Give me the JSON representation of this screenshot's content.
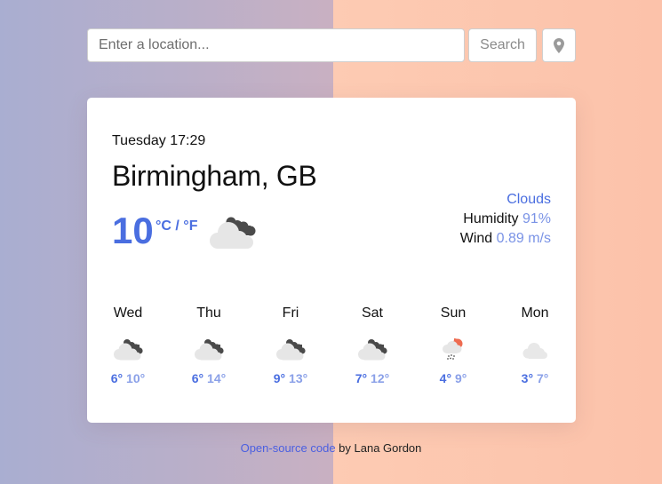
{
  "search": {
    "placeholder": "Enter a location...",
    "value": "",
    "button_label": "Search",
    "location_icon": "map-pin-icon"
  },
  "current": {
    "datetime": "Tuesday 17:29",
    "city": "Birmingham, GB",
    "temperature": "10",
    "unit_c": "°C",
    "unit_separator": " / ",
    "unit_f": "°F",
    "icon": "broken-clouds-icon",
    "description": "Clouds",
    "humidity_label": "Humidity",
    "humidity_value": "91%",
    "wind_label": "Wind",
    "wind_value": "0.89 m/s"
  },
  "forecast": [
    {
      "day": "Wed",
      "icon": "broken-clouds-icon",
      "min": "6°",
      "max": "10°"
    },
    {
      "day": "Thu",
      "icon": "broken-clouds-icon",
      "min": "6°",
      "max": "14°"
    },
    {
      "day": "Fri",
      "icon": "broken-clouds-icon",
      "min": "9°",
      "max": "13°"
    },
    {
      "day": "Sat",
      "icon": "broken-clouds-icon",
      "min": "7°",
      "max": "12°"
    },
    {
      "day": "Sun",
      "icon": "rain-sun-icon",
      "min": "4°",
      "max": "9°"
    },
    {
      "day": "Mon",
      "icon": "cloud-icon",
      "min": "3°",
      "max": "7°"
    }
  ],
  "footer": {
    "link_text": "Open-source code",
    "suffix": " by Lana Gordon"
  },
  "colors": {
    "accent": "#4a6ee0",
    "accent_light": "#7a93e6",
    "link": "#4a5fe0"
  }
}
